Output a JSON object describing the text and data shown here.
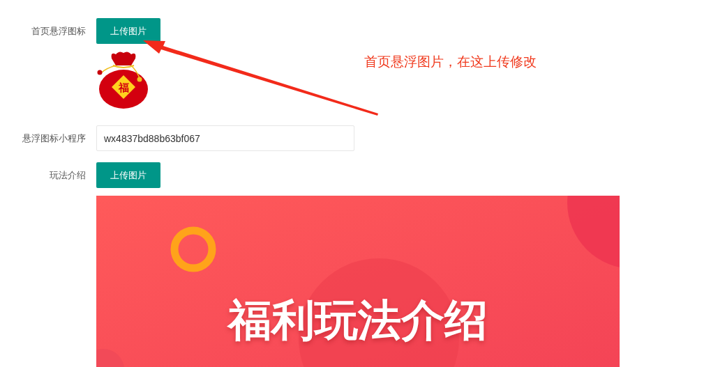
{
  "form": [
    {
      "kind": "upload",
      "label": "首页悬浮图标",
      "button": "上传图片",
      "preview": {
        "kind": "bag",
        "char": "福"
      }
    },
    {
      "kind": "text",
      "label": "悬浮图标小程序",
      "value": "wx4837bd88b63bf067"
    },
    {
      "kind": "upload",
      "label": "玩法介绍",
      "button": "上传图片",
      "preview": {
        "kind": "banner",
        "title": "福利玩法介绍"
      }
    }
  ],
  "annotation": {
    "text": "首页悬浮图片，在这上传修改"
  }
}
